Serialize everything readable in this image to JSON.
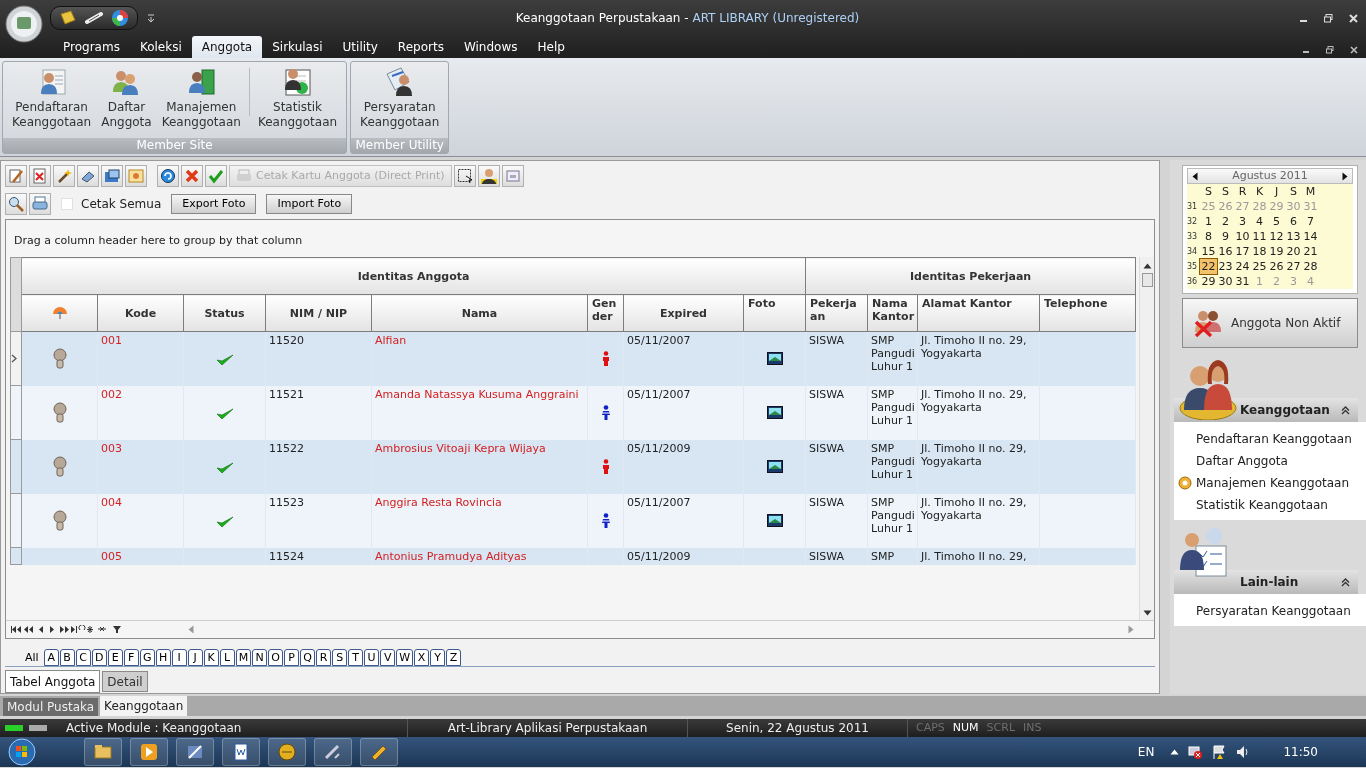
{
  "window": {
    "title": "Keanggotaan Perpustakaan -",
    "app_name": "ART LIBRARY (Unregistered)"
  },
  "menu": [
    {
      "label": "Programs",
      "selected": false
    },
    {
      "label": "Koleksi",
      "selected": false
    },
    {
      "label": "Anggota",
      "selected": true
    },
    {
      "label": "Sirkulasi",
      "selected": false
    },
    {
      "label": "Utility",
      "selected": false
    },
    {
      "label": "Reports",
      "selected": false
    },
    {
      "label": "Windows",
      "selected": false
    },
    {
      "label": "Help",
      "selected": false
    }
  ],
  "ribbon": {
    "groups": [
      {
        "caption": "Member Site",
        "buttons": [
          {
            "label": "Pendaftaran\nKeanggotaan",
            "kind": "registration"
          },
          {
            "label": "Daftar\nAnggota",
            "kind": "list"
          },
          {
            "label": "Manajemen\nKeanggotaan",
            "kind": "management"
          },
          {
            "label": "Statistik\nKeanggotaan",
            "kind": "statistics"
          }
        ]
      },
      {
        "caption": "Member Utility",
        "buttons": [
          {
            "label": "Persyaratan\nKeanggotaan",
            "kind": "requirements"
          }
        ]
      }
    ]
  },
  "toolbar": {
    "print_card": {
      "label": "Cetak Kartu Anggota (Direct Print)",
      "disabled": true
    },
    "print_all": {
      "label": "Cetak Semua",
      "checked": false
    },
    "buttons": [
      "Export Foto",
      "Import Foto"
    ]
  },
  "grid": {
    "group_hint": "Drag a column header here to group by that column",
    "bands": [
      "Identitas Anggota",
      "Identitas Pekerjaan"
    ],
    "columns": [
      "Kode",
      "Status",
      "NIM / NIP",
      "Nama",
      "Gender",
      "Expired",
      "Foto",
      "Pekerjaan",
      "Nama Kantor",
      "Alamat Kantor",
      "Telephone"
    ],
    "rows": [
      {
        "selected": true,
        "kode": "001",
        "active": true,
        "nim": "11520",
        "nama": "Alfian",
        "female": true,
        "expired": "05/11/2007",
        "has_photo": true,
        "pekerjaan": "SISWA",
        "nama_kantor": "SMP Pangudi Luhur 1",
        "alamat": "Jl. Timoho II no. 29, Yogyakarta"
      },
      {
        "selected": false,
        "kode": "002",
        "active": true,
        "nim": "11521",
        "nama": "Amanda Natassya Kusuma Anggraini",
        "female": false,
        "expired": "05/11/2007",
        "has_photo": true,
        "pekerjaan": "SISWA",
        "nama_kantor": "SMP Pangudi Luhur 1",
        "alamat": "Jl. Timoho II no. 29, Yogyakarta"
      },
      {
        "selected": false,
        "kode": "003",
        "active": true,
        "nim": "11522",
        "nama": "Ambrosius Vitoaji Kepra Wijaya",
        "female": true,
        "expired": "05/11/2009",
        "has_photo": true,
        "pekerjaan": "SISWA",
        "nama_kantor": "SMP Pangudi Luhur 1",
        "alamat": "Jl. Timoho II no. 29, Yogyakarta"
      },
      {
        "selected": false,
        "kode": "004",
        "active": true,
        "nim": "11523",
        "nama": "Anggira Resta Rovincia",
        "female": false,
        "expired": "05/11/2007",
        "has_photo": true,
        "pekerjaan": "SISWA",
        "nama_kantor": "SMP Pangudi Luhur 1",
        "alamat": "Jl. Timoho II no. 29, Yogyakarta"
      },
      {
        "selected": false,
        "kode": "005",
        "active": false,
        "nim": "11524",
        "nama": "Antonius Pramudya Adityas",
        "has_photo": false,
        "expired": "05/11/2009",
        "pekerjaan": "SISWA",
        "nama_kantor": "SMP",
        "alamat": "Jl. Timoho II no. 29,"
      }
    ]
  },
  "alphabet": [
    {
      "label": "All",
      "selected": true
    },
    {
      "label": "A",
      "selected": false
    },
    {
      "label": "B",
      "selected": false
    },
    {
      "label": "C",
      "selected": false
    },
    {
      "label": "D",
      "selected": false
    },
    {
      "label": "E",
      "selected": false
    },
    {
      "label": "F",
      "selected": false
    },
    {
      "label": "G",
      "selected": false
    },
    {
      "label": "H",
      "selected": false
    },
    {
      "label": "I",
      "selected": false
    },
    {
      "label": "J",
      "selected": false
    },
    {
      "label": "K",
      "selected": false
    },
    {
      "label": "L",
      "selected": false
    },
    {
      "label": "M",
      "selected": false
    },
    {
      "label": "N",
      "selected": false
    },
    {
      "label": "O",
      "selected": false
    },
    {
      "label": "P",
      "selected": false
    },
    {
      "label": "Q",
      "selected": false
    },
    {
      "label": "R",
      "selected": false
    },
    {
      "label": "S",
      "selected": false
    },
    {
      "label": "T",
      "selected": false
    },
    {
      "label": "U",
      "selected": false
    },
    {
      "label": "V",
      "selected": false
    },
    {
      "label": "W",
      "selected": false
    },
    {
      "label": "X",
      "selected": false
    },
    {
      "label": "Y",
      "selected": false
    },
    {
      "label": "Z",
      "selected": false
    }
  ],
  "view_tabs": [
    {
      "label": "Tabel Anggota",
      "selected": true
    },
    {
      "label": "Detail",
      "selected": false
    }
  ],
  "calendar": {
    "month": "Agustus 2011",
    "weekdays": [
      "S",
      "S",
      "R",
      "K",
      "J",
      "S",
      "M"
    ],
    "weeks": [
      {
        "number": "31",
        "days": [
          {
            "day": "25",
            "muted": true,
            "selected": false
          },
          {
            "day": "26",
            "muted": true,
            "selected": false
          },
          {
            "day": "27",
            "muted": true,
            "selected": false
          },
          {
            "day": "28",
            "muted": true,
            "selected": false
          },
          {
            "day": "29",
            "muted": true,
            "selected": false
          },
          {
            "day": "30",
            "muted": true,
            "selected": false
          },
          {
            "day": "31",
            "muted": true,
            "selected": false
          }
        ]
      },
      {
        "number": "32",
        "days": [
          {
            "day": "1",
            "muted": false,
            "selected": false
          },
          {
            "day": "2",
            "muted": false,
            "selected": false
          },
          {
            "day": "3",
            "muted": false,
            "selected": false
          },
          {
            "day": "4",
            "muted": false,
            "selected": false
          },
          {
            "day": "5",
            "muted": false,
            "selected": false
          },
          {
            "day": "6",
            "muted": false,
            "selected": false
          },
          {
            "day": "7",
            "muted": false,
            "selected": false
          }
        ]
      },
      {
        "number": "33",
        "days": [
          {
            "day": "8",
            "muted": false,
            "selected": false
          },
          {
            "day": "9",
            "muted": false,
            "selected": false
          },
          {
            "day": "10",
            "muted": false,
            "selected": false
          },
          {
            "day": "11",
            "muted": false,
            "selected": false
          },
          {
            "day": "12",
            "muted": false,
            "selected": false
          },
          {
            "day": "13",
            "muted": false,
            "selected": false
          },
          {
            "day": "14",
            "muted": false,
            "selected": false
          }
        ]
      },
      {
        "number": "34",
        "days": [
          {
            "day": "15",
            "muted": false,
            "selected": false
          },
          {
            "day": "16",
            "muted": false,
            "selected": false
          },
          {
            "day": "17",
            "muted": false,
            "selected": false
          },
          {
            "day": "18",
            "muted": false,
            "selected": false
          },
          {
            "day": "19",
            "muted": false,
            "selected": false
          },
          {
            "day": "20",
            "muted": false,
            "selected": false
          },
          {
            "day": "21",
            "muted": false,
            "selected": false
          }
        ]
      },
      {
        "number": "35",
        "days": [
          {
            "day": "22",
            "muted": false,
            "selected": true
          },
          {
            "day": "23",
            "muted": false,
            "selected": false
          },
          {
            "day": "24",
            "muted": false,
            "selected": false
          },
          {
            "day": "25",
            "muted": false,
            "selected": false
          },
          {
            "day": "26",
            "muted": false,
            "selected": false
          },
          {
            "day": "27",
            "muted": false,
            "selected": false
          },
          {
            "day": "28",
            "muted": false,
            "selected": false
          }
        ]
      },
      {
        "number": "36",
        "days": [
          {
            "day": "29",
            "muted": false,
            "selected": false
          },
          {
            "day": "30",
            "muted": false,
            "selected": false
          },
          {
            "day": "31",
            "muted": false,
            "selected": false
          },
          {
            "day": "1",
            "muted": true,
            "selected": false
          },
          {
            "day": "2",
            "muted": true,
            "selected": false
          },
          {
            "day": "3",
            "muted": true,
            "selected": false
          },
          {
            "day": "4",
            "muted": true,
            "selected": false
          }
        ]
      }
    ]
  },
  "inactive_button": "Anggota Non Aktif",
  "side_groups": [
    {
      "title": "Keanggotaan",
      "kind": "members",
      "expanded": true,
      "items": [
        {
          "label": "Pendaftaran Keanggotaan",
          "selected": false
        },
        {
          "label": "Daftar Anggota",
          "selected": false
        },
        {
          "label": "Manajemen Keanggotaan",
          "selected": true
        },
        {
          "label": "Statistik Keanggotaan",
          "selected": false
        }
      ]
    },
    {
      "title": "Lain-lain",
      "kind": "other",
      "expanded": true,
      "items": [
        {
          "label": "Persyaratan Keanggotaan",
          "selected": false
        }
      ]
    }
  ],
  "module_tabs": [
    {
      "label": "Modul Pustaka",
      "selected": false
    },
    {
      "label": "Keanggotaan",
      "selected": true
    }
  ],
  "status_bar": {
    "module": "Active Module : Keanggotaan",
    "app": "Art-Library Aplikasi Perpustakaan",
    "date": "Senin, 22 Agustus 2011",
    "keys": [
      {
        "label": "CAPS",
        "on": false
      },
      {
        "label": "NUM",
        "on": true
      },
      {
        "label": "SCRL",
        "on": false
      },
      {
        "label": "INS",
        "on": false
      }
    ]
  },
  "taskbar": {
    "language": "EN",
    "time": "11:50"
  }
}
